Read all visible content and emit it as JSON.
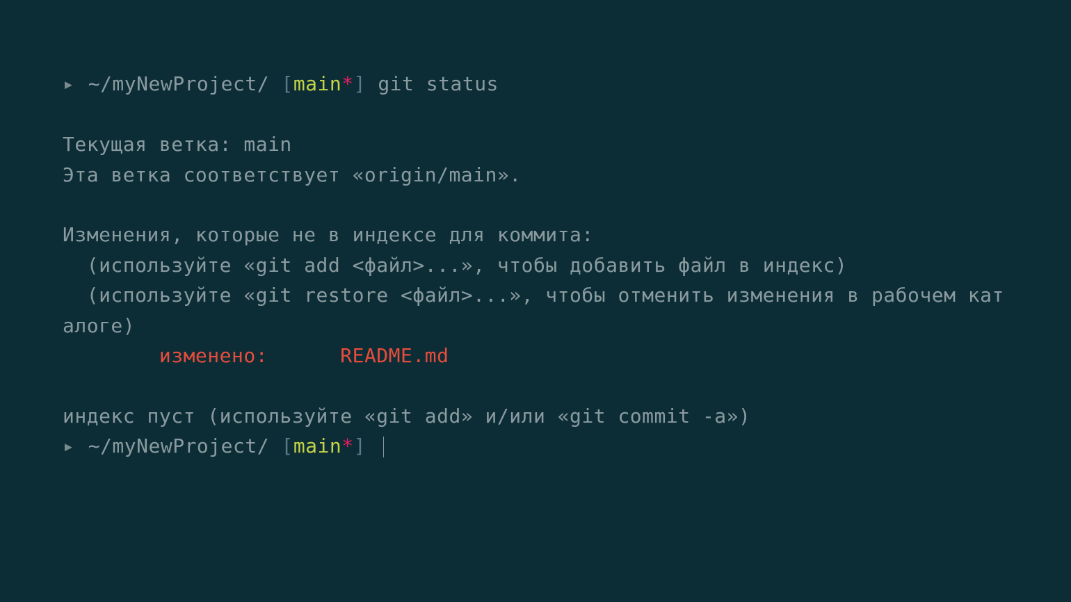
{
  "prompt1": {
    "arrow": "▸",
    "path": "~/myNewProject/",
    "bracketOpen": "[",
    "branch": "main",
    "asterisk": "*",
    "bracketClose": "]",
    "command": "git status"
  },
  "output": {
    "line1": "Текущая ветка: main",
    "line2": "Эта ветка соответствует «origin/main».",
    "line3": "Изменения, которые не в индексе для коммита:",
    "line4": "  (используйте «git add <файл>...», чтобы добавить файл в индекс)",
    "line5": "  (используйте «git restore <файл>...», чтобы отменить изменения в рабочем каталоге)",
    "modifiedLabel": "        изменено:      ",
    "modifiedFile": "README.md",
    "line7": "индекс пуст (используйте «git add» и/или «git commit -a»)"
  },
  "prompt2": {
    "arrow": "▸",
    "path": "~/myNewProject/",
    "bracketOpen": "[",
    "branch": "main",
    "asterisk": "*",
    "bracketClose": "]"
  }
}
